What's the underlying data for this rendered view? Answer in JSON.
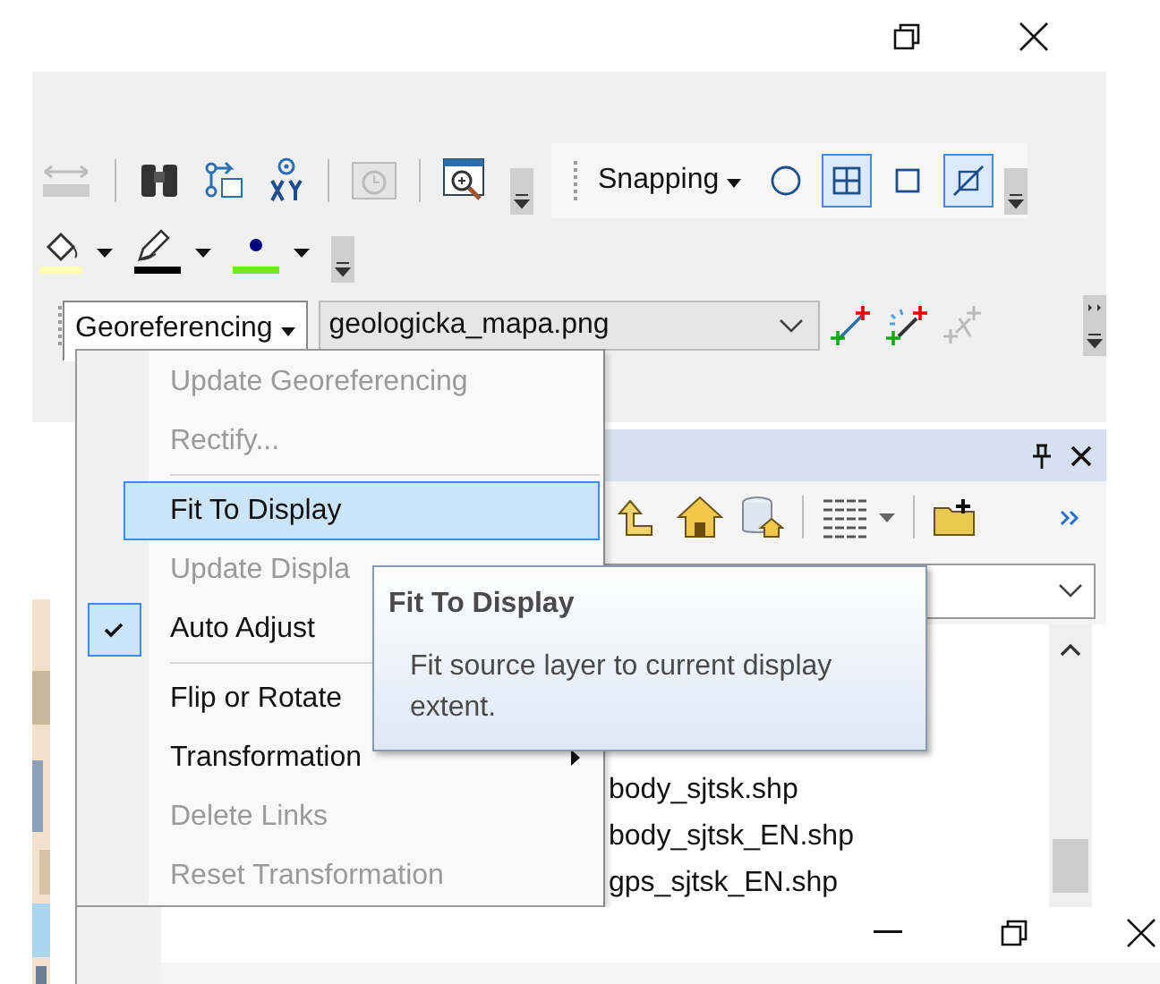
{
  "snapping": {
    "label": "Snapping",
    "options": [
      {
        "kind": "point",
        "selected": false
      },
      {
        "kind": "vertex",
        "selected": true
      },
      {
        "kind": "edge",
        "selected": false
      },
      {
        "kind": "end",
        "selected": true
      }
    ]
  },
  "georeferencing_toolbar": {
    "menu_label": "Georeferencing",
    "layer": "geologicka_mapa.png"
  },
  "menu": [
    {
      "kind": "item",
      "label": "Update Georeferencing",
      "disabled": true,
      "checked": false,
      "selected": false,
      "submenu": false
    },
    {
      "kind": "item",
      "label": "Rectify...",
      "disabled": true,
      "checked": false,
      "selected": false,
      "submenu": false
    },
    {
      "kind": "separator"
    },
    {
      "kind": "item",
      "label": "Fit To Display",
      "disabled": false,
      "checked": false,
      "selected": true,
      "submenu": false
    },
    {
      "kind": "item",
      "label": "Update Displa",
      "disabled": true,
      "checked": false,
      "selected": false,
      "submenu": false
    },
    {
      "kind": "item",
      "label": "Auto Adjust",
      "disabled": false,
      "checked": true,
      "selected": false,
      "submenu": false
    },
    {
      "kind": "separator"
    },
    {
      "kind": "item",
      "label": "Flip or Rotate",
      "disabled": false,
      "checked": false,
      "selected": false,
      "submenu": false
    },
    {
      "kind": "item",
      "label": "Transformation",
      "disabled": false,
      "checked": false,
      "selected": false,
      "submenu": true
    },
    {
      "kind": "item",
      "label": "Delete Links",
      "disabled": true,
      "checked": false,
      "selected": false,
      "submenu": false
    },
    {
      "kind": "item",
      "label": "Reset Transformation",
      "disabled": true,
      "checked": false,
      "selected": false,
      "submenu": false
    }
  ],
  "tooltip": {
    "title": "Fit To Display",
    "text": "Fit source layer to current display extent."
  },
  "catalog": {
    "files": [
      "body_sjtsk.shp",
      "body_sjtsk_EN.shp",
      "gps_sjtsk_EN.shp"
    ]
  }
}
